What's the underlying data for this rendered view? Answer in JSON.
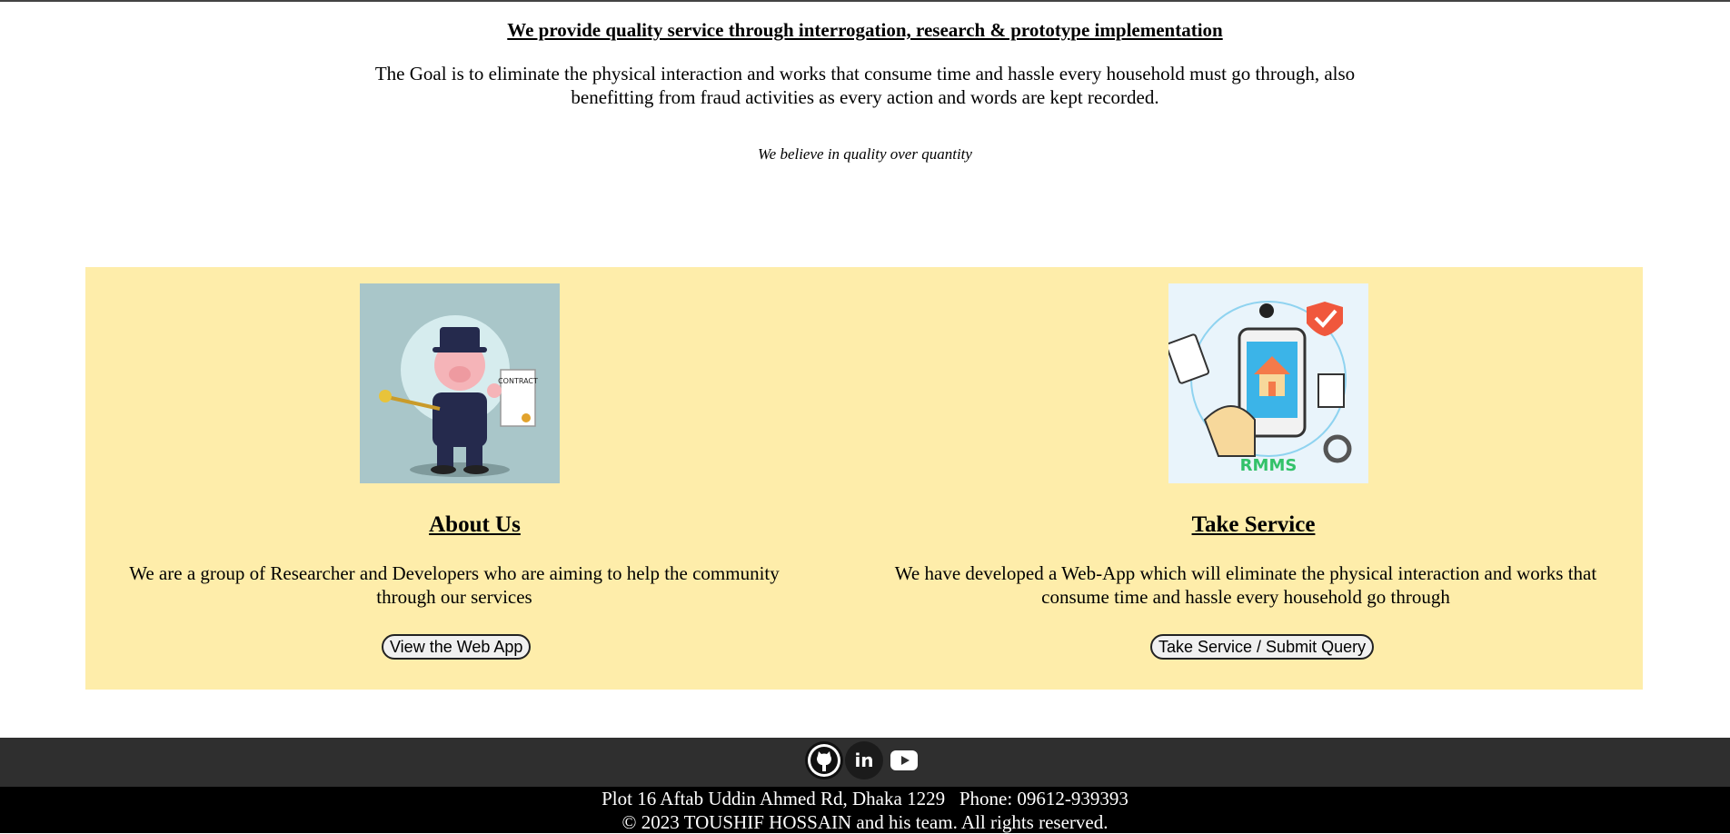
{
  "intro": {
    "headline": "We provide quality service through interrogation, research & prototype implementation",
    "goal": "The Goal is to eliminate the physical interaction and works that consume time and hassle every household must go through, also benefitting from fraud activities as every action and words are kept recorded.",
    "tagline": "We believe in quality over quantity"
  },
  "cards": [
    {
      "title": "About Us",
      "text": "We are a group of Researcher and Developers who are aiming to help the community through our services",
      "button": "View the Web App"
    },
    {
      "title": "Take Service",
      "text": "We have developed a Web-App which will eliminate the physical interaction and works that consume time and hassle every household go through",
      "button": "Take Service / Submit Query",
      "image_caption": "RMMS"
    }
  ],
  "social": [
    {
      "icon": "github-icon"
    },
    {
      "icon": "linkedin-icon",
      "glyph": "in"
    },
    {
      "icon": "youtube-icon"
    }
  ],
  "footer": {
    "address_line": "Plot 16 Aftab Uddin Ahmed Rd, Dhaka 1229   Phone: 09612-939393",
    "copyright": "© 2023 TOUSHIF HOSSAIN and his team. All rights reserved."
  },
  "colors": {
    "card_background": "#feedaa",
    "social_bar": "#2f2f2f",
    "footer": "#000000"
  }
}
